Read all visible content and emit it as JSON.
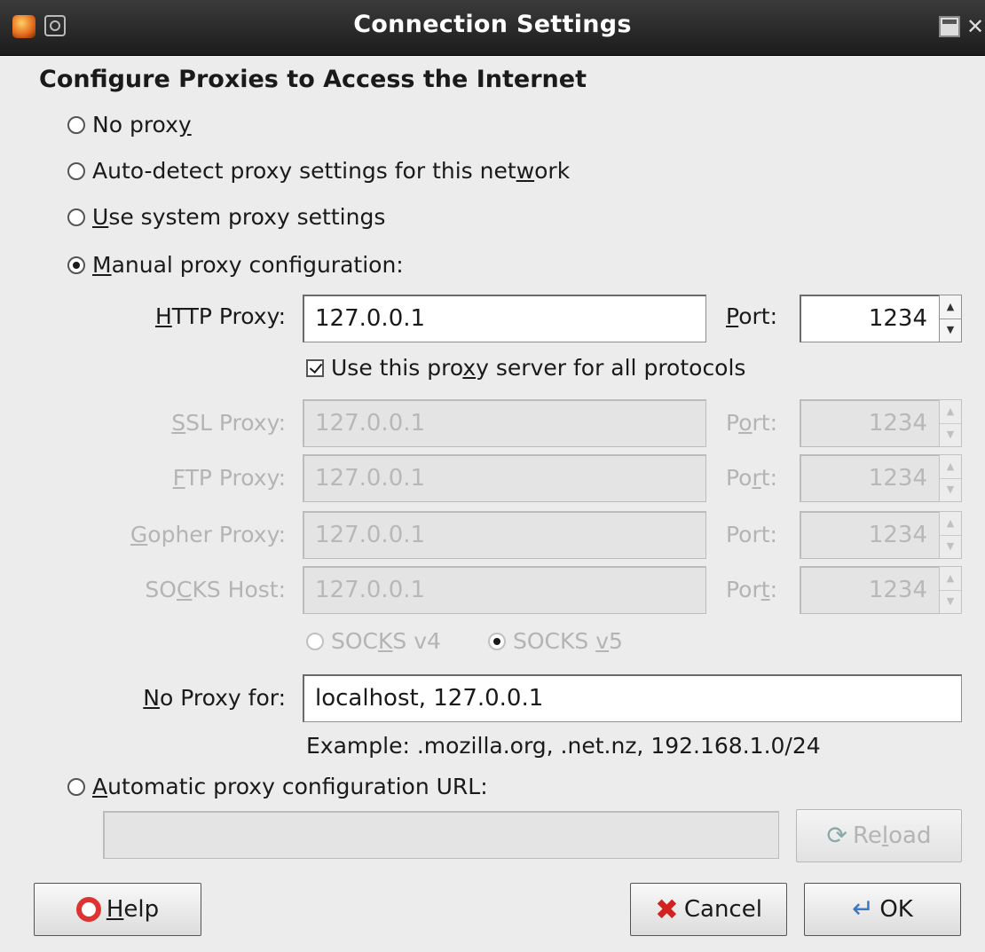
{
  "window": {
    "title": "Connection Settings"
  },
  "heading": "Configure Proxies to Access the Internet",
  "options": {
    "no_proxy": {
      "before": "No prox",
      "u": "y",
      "after": ""
    },
    "auto_detect": {
      "before": "Auto-detect proxy settings for this net",
      "u": "w",
      "after": "ork"
    },
    "system": {
      "before": "",
      "u": "U",
      "after": "se system proxy settings"
    },
    "manual": {
      "before": "",
      "u": "M",
      "after": "anual proxy configuration:"
    },
    "auto_url": {
      "before": "",
      "u": "A",
      "after": "utomatic proxy configuration URL:"
    }
  },
  "http": {
    "label_u": "H",
    "label_rest": "TTP Proxy:",
    "value": "127.0.0.1",
    "port_label_u": "P",
    "port_label_rest": "ort:",
    "port": "1234"
  },
  "same_proxy": {
    "before": "Use this pro",
    "u": "x",
    "after": "y server for all protocols",
    "checked": true
  },
  "ssl": {
    "label_u": "S",
    "label_rest": "SL Proxy:",
    "value": "127.0.0.1",
    "port_label_pre": "P",
    "port_label_u": "o",
    "port_label_rest": "rt:",
    "port": "1234"
  },
  "ftp": {
    "label_u": "F",
    "label_rest": "TP Proxy:",
    "value": "127.0.0.1",
    "port_label_pre": "Po",
    "port_label_u": "r",
    "port_label_rest": "t:",
    "port": "1234"
  },
  "gopher": {
    "label_u": "G",
    "label_rest": "opher Proxy:",
    "value": "127.0.0.1",
    "port_label": "Port:",
    "port": "1234"
  },
  "socks": {
    "label_pre": "SO",
    "label_u": "C",
    "label_rest": "KS Host:",
    "value": "127.0.0.1",
    "port_label_pre": "Por",
    "port_label_u": "t",
    "port_label_rest": ":",
    "port": "1234"
  },
  "socks_v4": {
    "before": "SOC",
    "u": "K",
    "after": "S v4"
  },
  "socks_v5": {
    "before": "SOCKS ",
    "u": "v",
    "after": "5"
  },
  "no_proxy_for": {
    "label_u": "N",
    "label_rest": "o Proxy for:",
    "value": "localhost, 127.0.0.1"
  },
  "example": "Example: .mozilla.org, .net.nz, 192.168.1.0/24",
  "auto_url_value": "",
  "buttons": {
    "reload": {
      "before": "Re",
      "u": "l",
      "after": "oad"
    },
    "help": {
      "before": "",
      "u": "H",
      "after": "elp"
    },
    "cancel": "Cancel",
    "ok": "OK"
  },
  "icons": {
    "app": "firefox-icon",
    "help": "lifebuoy-icon",
    "cancel": "red-x-icon",
    "ok": "return-arrow-icon",
    "reload": "reload-icon"
  }
}
